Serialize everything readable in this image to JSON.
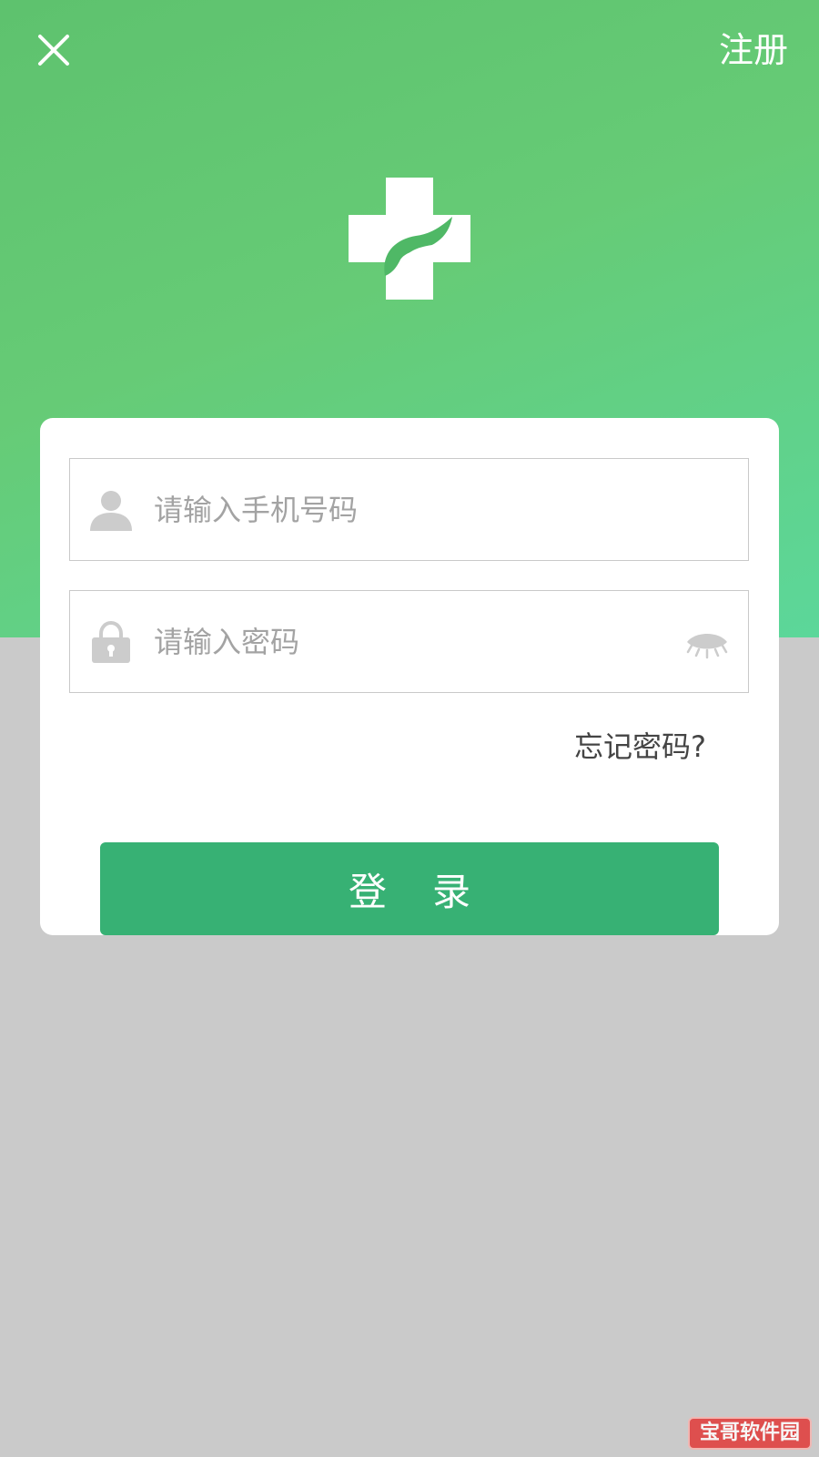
{
  "header": {
    "close_icon": "close-icon",
    "register_label": "注册"
  },
  "logo": {
    "icon": "medical-cross-hand-icon",
    "colors": {
      "cross": "#ffffff",
      "hand": "#4fb866"
    }
  },
  "form": {
    "phone": {
      "icon": "user-icon",
      "value": "",
      "placeholder": "请输入手机号码"
    },
    "password": {
      "icon": "lock-icon",
      "value": "",
      "placeholder": "请输入密码",
      "toggle_icon": "eye-closed-icon"
    },
    "forgot_label": "忘记密码?",
    "login_label": "登录"
  },
  "watermark": {
    "text": "宝哥软件园"
  },
  "colors": {
    "hero_green": "#62c872",
    "hero_teal": "#5cd79a",
    "background_gray": "#cacaca",
    "button_green": "#37b174",
    "card": "#ffffff",
    "placeholder_gray": "#a3a3a3",
    "icon_gray": "#cccccc"
  }
}
